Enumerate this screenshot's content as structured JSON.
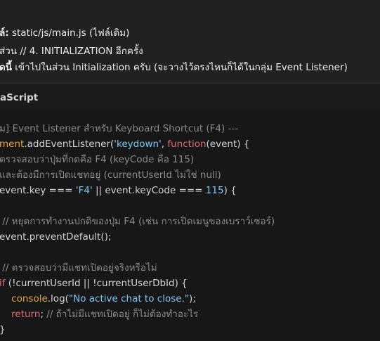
{
  "prose": {
    "line1_label": "ล์:",
    "line1_text": " static/js/main.js  (ไฟล์เดิม)",
    "line2_text": " ส่วน  // 4. INITIALIZATION  อีกครั้ง",
    "line3_label": "ดนี้",
    "line3_text": " เข้าไปในส่วน Initialization ครับ (จะวางไว้ตรงไหนก็ได้ในกลุ่ม Event Listener)"
  },
  "code_block": {
    "language": "aScript",
    "lines": [
      {
        "tokens": [
          {
            "t": "comment",
            "v": "ม] Event Listener สำหรับ Keyboard Shortcut (F4) ---"
          }
        ]
      },
      {
        "tokens": [
          {
            "t": "fn",
            "v": "ment"
          },
          {
            "t": "plain",
            "v": ".addEventListener("
          },
          {
            "t": "string",
            "v": "'keydown'"
          },
          {
            "t": "plain",
            "v": ", "
          },
          {
            "t": "keyword",
            "v": "function"
          },
          {
            "t": "plain",
            "v": "(event) {"
          }
        ]
      },
      {
        "tokens": [
          {
            "t": "comment",
            "v": "ตรวจสอบว่าปุ่มที่กดคือ F4 (keyCode คือ 115)"
          }
        ]
      },
      {
        "tokens": [
          {
            "t": "comment",
            "v": "และต้องมีการเปิดแชทอยู่ (currentUserId ไม่ใช่ null)"
          }
        ]
      },
      {
        "tokens": [
          {
            "t": "plain",
            "v": "event.key === "
          },
          {
            "t": "string",
            "v": "'F4'"
          },
          {
            "t": "plain",
            "v": " || event.keyCode === "
          },
          {
            "t": "number",
            "v": "115"
          },
          {
            "t": "plain",
            "v": ") {"
          }
        ]
      },
      {
        "tokens": [
          {
            "t": "plain",
            "v": ""
          }
        ]
      },
      {
        "tokens": [
          {
            "t": "comment",
            "v": " // หยุดการทำงานปกติของปุ่ม F4 (เช่น การเปิดเมนูของเบราว์เซอร์)"
          }
        ]
      },
      {
        "tokens": [
          {
            "t": "plain",
            "v": "event.preventDefault();"
          }
        ]
      },
      {
        "tokens": [
          {
            "t": "plain",
            "v": ""
          }
        ]
      },
      {
        "tokens": [
          {
            "t": "comment",
            "v": " // ตรวจสอบว่ามีแชทเปิดอยู่จริงหรือไม่"
          }
        ]
      },
      {
        "tokens": [
          {
            "t": "keyword",
            "v": "if"
          },
          {
            "t": "plain",
            "v": " (!currentUserId || !currentUserDbId) {"
          }
        ]
      },
      {
        "tokens": [
          {
            "t": "plain",
            "v": "    "
          },
          {
            "t": "fn",
            "v": "console"
          },
          {
            "t": "plain",
            "v": ".log("
          },
          {
            "t": "string",
            "v": "\"No active chat to close.\""
          },
          {
            "t": "plain",
            "v": ");"
          }
        ]
      },
      {
        "tokens": [
          {
            "t": "plain",
            "v": "    "
          },
          {
            "t": "keyword",
            "v": "return"
          },
          {
            "t": "plain",
            "v": "; "
          },
          {
            "t": "comment",
            "v": "// ถ้าไม่มีแชทเปิดอยู่ ก็ไม่ต้องทำอะไร"
          }
        ]
      },
      {
        "tokens": [
          {
            "t": "plain",
            "v": "}"
          }
        ]
      }
    ]
  }
}
